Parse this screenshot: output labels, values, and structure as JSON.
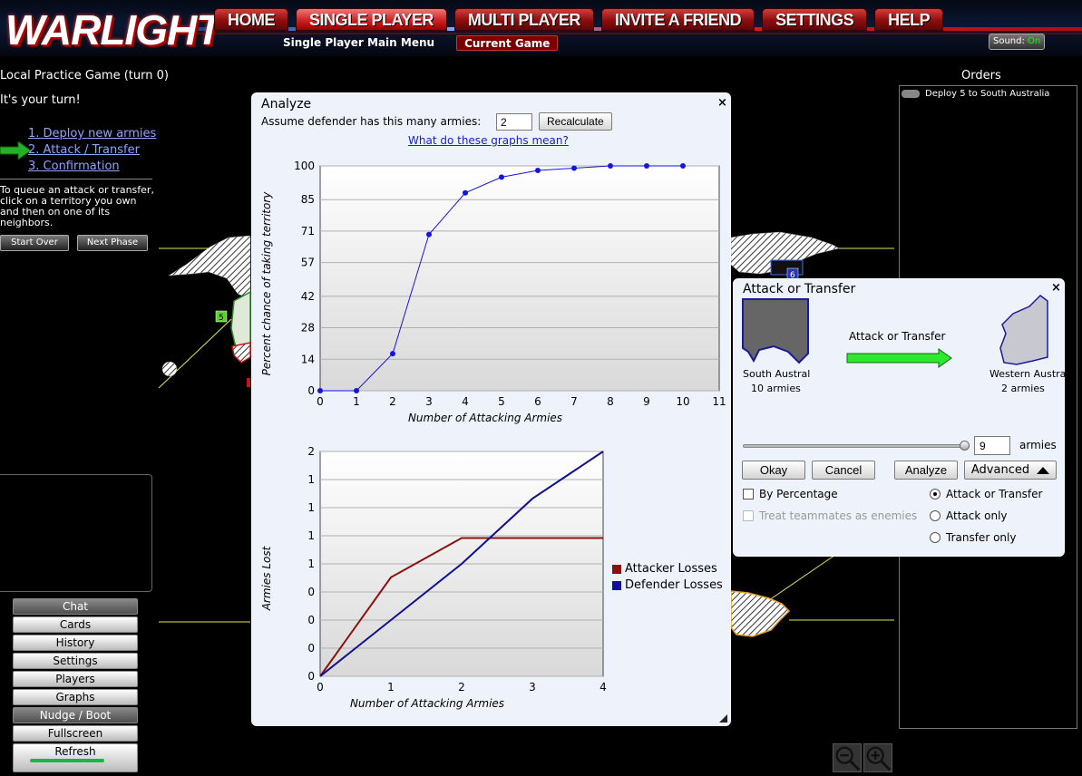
{
  "header": {
    "logo": "WARLIGHT",
    "nav": [
      "HOME",
      "SINGLE PLAYER",
      "MULTI PLAYER",
      "INVITE A FRIEND",
      "SETTINGS",
      "HELP"
    ],
    "subnav": [
      "Single Player Main Menu",
      "Current Game"
    ],
    "sound_label": "Sound:",
    "sound_value": "On"
  },
  "left": {
    "game_title": "Local Practice Game (turn 0)",
    "turn_text": "It's your turn!",
    "steps": [
      "1. Deploy new armies",
      "2. Attack / Transfer",
      "3. Confirmation"
    ],
    "instructions": "To queue an attack or transfer, click on a territory you own and then on one of its neighbors.",
    "start_over": "Start Over",
    "next_phase": "Next Phase",
    "menu": [
      "Chat",
      "Cards",
      "History",
      "Settings",
      "Players",
      "Graphs",
      "Nudge / Boot",
      "Fullscreen",
      "Refresh"
    ]
  },
  "map": {
    "label_5": "5",
    "label_6": "6"
  },
  "orders": {
    "title": "Orders",
    "items": [
      "Deploy 5 to South Australia"
    ]
  },
  "analyze": {
    "title": "Analyze",
    "close": "×",
    "assume_label": "Assume defender has this many armies:",
    "defender_armies": "2",
    "recalculate": "Recalculate",
    "graphs_link": "What do these graphs mean?",
    "legend_attacker": "Attacker Losses",
    "legend_defender": "Defender Losses",
    "attacker_color": "#8b1010",
    "defender_color": "#101090"
  },
  "chart_data": [
    {
      "type": "line",
      "xlabel": "Number of Attacking Armies",
      "ylabel": "Percent chance of taking territory",
      "xlim": [
        0,
        11
      ],
      "ylim": [
        0,
        100
      ],
      "x_ticks": [
        0,
        1,
        2,
        3,
        4,
        5,
        6,
        7,
        8,
        9,
        10,
        11
      ],
      "y_ticks": [
        0,
        14,
        28,
        42,
        57,
        71,
        85,
        100
      ],
      "grid": true,
      "series": [
        {
          "x": [
            0,
            1,
            2,
            3,
            4,
            5,
            6,
            7,
            8,
            9,
            10
          ],
          "values": [
            0,
            0,
            16.5,
            69.5,
            88,
            95,
            98,
            99,
            100,
            100,
            100
          ],
          "color": "#1515dd"
        }
      ]
    },
    {
      "type": "line",
      "xlabel": "Number of Attacking Armies",
      "ylabel": "Armies Lost",
      "xlim": [
        0,
        4
      ],
      "ylim": [
        0,
        2
      ],
      "x_ticks": [
        0,
        1,
        2,
        3,
        4
      ],
      "y_ticks": [
        0,
        0.25,
        0.5,
        0.75,
        1,
        1.25,
        1.5,
        1.75,
        2
      ],
      "y_tick_labels": [
        "0",
        "0",
        "0",
        "0",
        "1",
        "1",
        "1",
        "1",
        "2"
      ],
      "grid": true,
      "legend": "right",
      "series": [
        {
          "name": "Attacker Losses",
          "x": [
            0,
            1,
            2,
            3,
            4
          ],
          "values": [
            0,
            0.88,
            1.23,
            1.23,
            1.23
          ],
          "color": "#8b1010"
        },
        {
          "name": "Defender Losses",
          "x": [
            0,
            1,
            2,
            3,
            4
          ],
          "values": [
            0,
            0.5,
            1.0,
            1.58,
            2.0
          ],
          "color": "#101090"
        }
      ]
    }
  ],
  "attack": {
    "title": "Attack or Transfer",
    "close": "×",
    "from_name": "South Austral",
    "from_armies": "10 armies",
    "to_name": "Western Australia",
    "to_armies": "2 armies",
    "arrow_label": "Attack or Transfer",
    "armies_value": "9",
    "armies_label": "armies",
    "okay": "Okay",
    "cancel": "Cancel",
    "analyze": "Analyze",
    "advanced": "Advanced",
    "by_percentage": "By Percentage",
    "treat_teammates": "Treat teammates as enemies",
    "attack_or_transfer": "Attack or Transfer",
    "attack_only": "Attack only",
    "transfer_only": "Transfer only",
    "arrow_color": "#2ee82e",
    "territory_fill": "#666666",
    "territory_to_fill": "#c8c8d0"
  }
}
